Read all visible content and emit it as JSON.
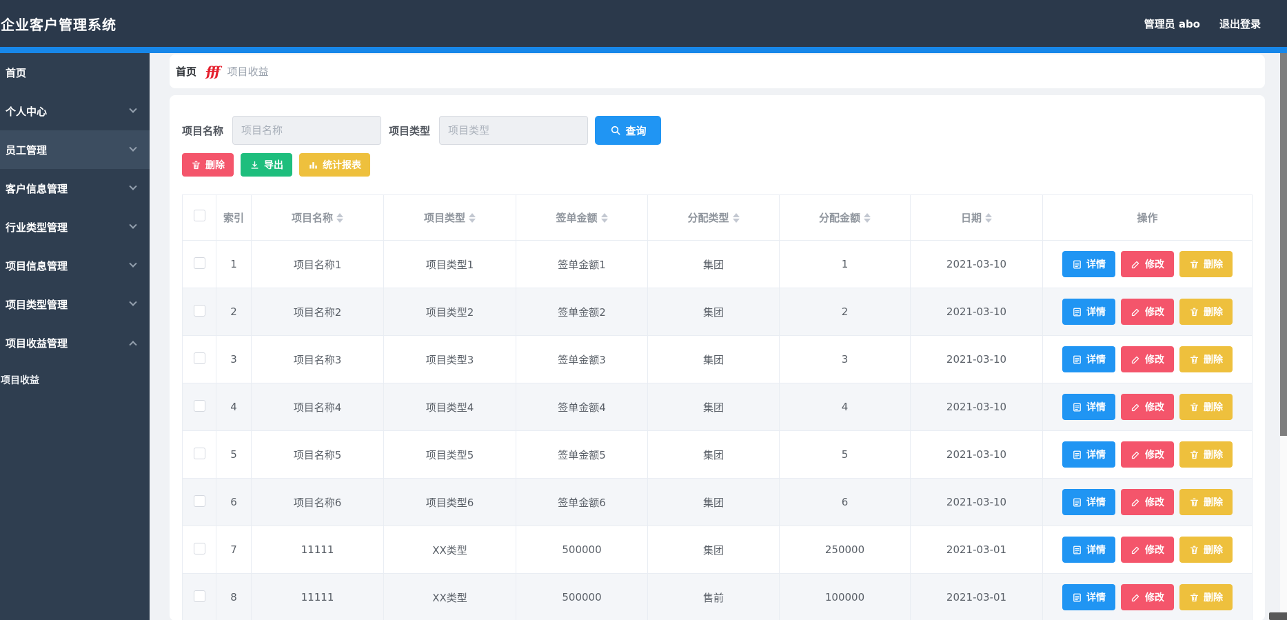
{
  "topbar": {
    "title": "企业客户管理系统",
    "user": "管理员 abo",
    "logout": "退出登录"
  },
  "sidebar": {
    "items": [
      {
        "label": "首页",
        "arrow": "none",
        "active": false
      },
      {
        "label": "个人中心",
        "arrow": "down",
        "active": false
      },
      {
        "label": "员工管理",
        "arrow": "down",
        "active": true
      },
      {
        "label": "客户信息管理",
        "arrow": "down",
        "active": false
      },
      {
        "label": "行业类型管理",
        "arrow": "down",
        "active": false
      },
      {
        "label": "项目信息管理",
        "arrow": "down",
        "active": false
      },
      {
        "label": "项目类型管理",
        "arrow": "down",
        "active": false
      },
      {
        "label": "项目收益管理",
        "arrow": "up",
        "active": false
      }
    ],
    "subitems": [
      {
        "label": "项目收益"
      }
    ]
  },
  "breadcrumb": {
    "home": "首页",
    "separator_glyph": "fff",
    "current": "项目收益"
  },
  "search": {
    "fields": [
      {
        "label": "项目名称",
        "placeholder": "项目名称",
        "value": ""
      },
      {
        "label": "项目类型",
        "placeholder": "项目类型",
        "value": ""
      }
    ],
    "query_label": "查询",
    "query_icon": "search-icon"
  },
  "toolbar": {
    "delete_label": "删除",
    "export_label": "导出",
    "report_label": "统计报表",
    "icons": [
      "trash-icon",
      "download-icon",
      "bar-chart-icon"
    ]
  },
  "table": {
    "columns": [
      {
        "label": "索引",
        "sortable": false
      },
      {
        "label": "项目名称",
        "sortable": true
      },
      {
        "label": "项目类型",
        "sortable": true
      },
      {
        "label": "签单金额",
        "sortable": true
      },
      {
        "label": "分配类型",
        "sortable": true
      },
      {
        "label": "分配金额",
        "sortable": true
      },
      {
        "label": "日期",
        "sortable": true
      },
      {
        "label": "操作",
        "sortable": false
      }
    ],
    "rows": [
      [
        "1",
        "项目名称1",
        "项目类型1",
        "签单金额1",
        "集团",
        "1",
        "2021-03-10"
      ],
      [
        "2",
        "项目名称2",
        "项目类型2",
        "签单金额2",
        "集团",
        "2",
        "2021-03-10"
      ],
      [
        "3",
        "项目名称3",
        "项目类型3",
        "签单金额3",
        "集团",
        "3",
        "2021-03-10"
      ],
      [
        "4",
        "项目名称4",
        "项目类型4",
        "签单金额4",
        "集团",
        "4",
        "2021-03-10"
      ],
      [
        "5",
        "项目名称5",
        "项目类型5",
        "签单金额5",
        "集团",
        "5",
        "2021-03-10"
      ],
      [
        "6",
        "项目名称6",
        "项目类型6",
        "签单金额6",
        "集团",
        "6",
        "2021-03-10"
      ],
      [
        "7",
        "11111",
        "XX类型",
        "500000",
        "集团",
        "250000",
        "2021-03-01"
      ],
      [
        "8",
        "11111",
        "XX类型",
        "500000",
        "售前",
        "100000",
        "2021-03-01"
      ]
    ],
    "row_actions": {
      "detail": "详情",
      "edit": "修改",
      "delete": "删除"
    }
  },
  "colors": {
    "topbar_bg": "#2b394b",
    "sidebar_bg": "#2f3e50",
    "sidebar_active_bg": "#3c4d60",
    "accent_blue": "#1787e9",
    "primary_blue": "#2095f3",
    "danger_red": "#f4556b",
    "success_green": "#1ebe7d",
    "warning_yellow": "#eec03d",
    "page_bg": "#f0f2f5"
  }
}
